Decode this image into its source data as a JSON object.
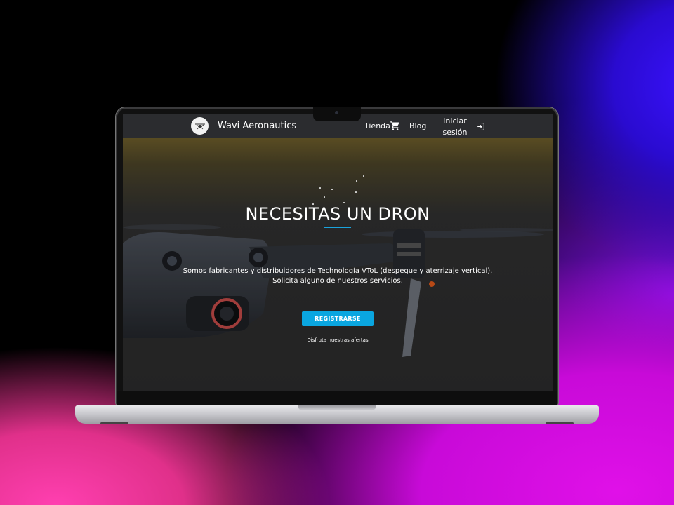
{
  "navbar": {
    "brand": "Wavi Aeronautics",
    "links": {
      "tienda": "Tienda",
      "blog": "Blog",
      "login_line1": "Iniciar",
      "login_line2": "sesión"
    },
    "icons": [
      "drone-logo-icon",
      "cart-icon",
      "login-icon"
    ]
  },
  "hero": {
    "title": "NECESITAS UN DRON",
    "subtitle_line1": "Somos fabricantes y distribuidores de Technología VToL (despegue y aterrizaje vertical).",
    "subtitle_line2": "Solicita alguno de nuestros servicios.",
    "cta_label": "REGISTRARSE",
    "offers_text": "Disfruta nuestras afertas"
  },
  "colors": {
    "accent": "#0aa6e0",
    "navbar": "#2b2c2f",
    "background_purple": "#c80ad8",
    "background_blue": "#2a0bd0",
    "background_pink": "#ff3fb0"
  }
}
